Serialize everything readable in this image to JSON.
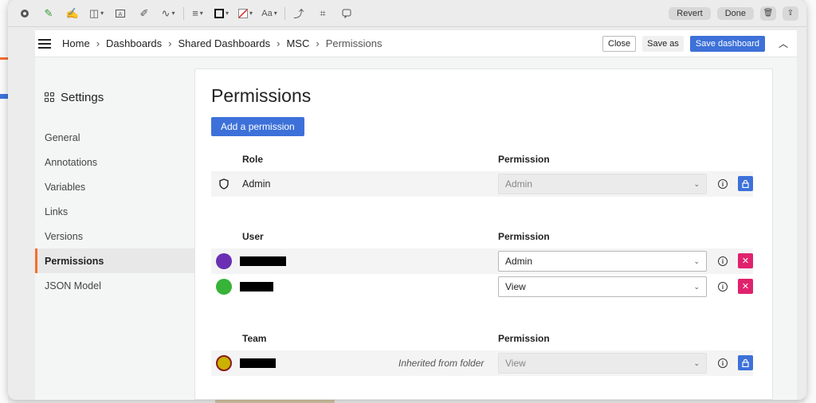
{
  "preview_toolbar": {
    "revert_label": "Revert",
    "done_label": "Done",
    "font_label": "Aa"
  },
  "breadcrumb": {
    "items": [
      "Home",
      "Dashboards",
      "Shared Dashboards",
      "MSC",
      "Permissions"
    ]
  },
  "top_actions": {
    "close": "Close",
    "save_as": "Save as",
    "save_dashboard": "Save dashboard"
  },
  "sidebar": {
    "title": "Settings",
    "items": [
      {
        "label": "General"
      },
      {
        "label": "Annotations"
      },
      {
        "label": "Variables"
      },
      {
        "label": "Links"
      },
      {
        "label": "Versions"
      },
      {
        "label": "Permissions",
        "active": true
      },
      {
        "label": "JSON Model"
      }
    ]
  },
  "page": {
    "title": "Permissions",
    "add_button": "Add a permission"
  },
  "sections": {
    "role": {
      "col_name": "Role",
      "col_perm": "Permission",
      "rows": [
        {
          "name": "Admin",
          "permission": "Admin",
          "disabled": true,
          "action": "lock"
        }
      ]
    },
    "user": {
      "col_name": "User",
      "col_perm": "Permission",
      "rows": [
        {
          "permission": "Admin",
          "avatar_color": "#6a2fb3",
          "action": "delete"
        },
        {
          "permission": "View",
          "avatar_color": "#37b337",
          "action": "delete"
        }
      ]
    },
    "team": {
      "col_name": "Team",
      "col_perm": "Permission",
      "rows": [
        {
          "inherited": "Inherited from folder",
          "permission": "View",
          "avatar_color": "#c9b200",
          "disabled": true,
          "action": "lock"
        }
      ]
    }
  },
  "colors": {
    "primary": "#3d71d9",
    "danger": "#e0226e",
    "active_accent": "#f46f30"
  }
}
